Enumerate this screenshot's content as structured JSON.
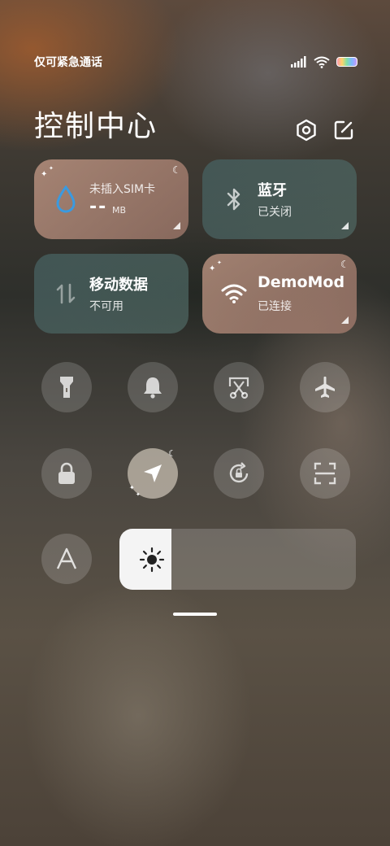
{
  "status_bar": {
    "text": "仅可紧急通话",
    "icons": [
      "signal-icon",
      "wifi-icon",
      "battery-icon"
    ]
  },
  "header": {
    "title": "控制中心",
    "settings_icon": "settings-hexagon-icon",
    "edit_icon": "edit-icon"
  },
  "tiles": {
    "data_usage": {
      "title": "未插入SIM卡",
      "value": "--",
      "unit": "MB",
      "icon": "water-drop-icon"
    },
    "bluetooth": {
      "title": "蓝牙",
      "status": "已关闭",
      "icon": "bluetooth-icon"
    },
    "mobile_data": {
      "title": "移动数据",
      "status": "不可用",
      "icon": "mobile-data-arrows-icon"
    },
    "wifi": {
      "title": "DemoMod",
      "status": "已连接",
      "icon": "wifi-icon"
    }
  },
  "toggles_row1": [
    "flashlight-icon",
    "bell-icon",
    "screenshot-scissors-icon",
    "airplane-icon"
  ],
  "toggles_row2": [
    "lock-icon",
    "location-arrow-icon",
    "rotation-lock-icon",
    "scan-icon"
  ],
  "font_size_icon": "font-a-icon",
  "brightness": {
    "level": 0.22,
    "icon": "sun-icon"
  },
  "colors": {
    "tile_warm": "#c9a08c",
    "tile_cool": "#4f6a68",
    "water_drop": "#3a9ae0",
    "brightness_fill": "#f4f4f4"
  }
}
